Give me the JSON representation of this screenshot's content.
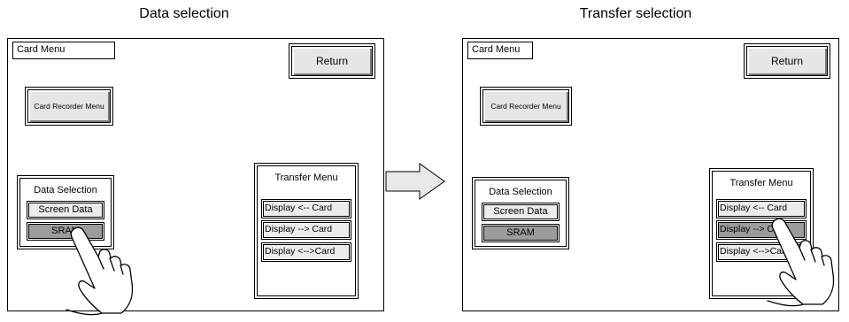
{
  "captions": {
    "left": "Data selection",
    "right": "Transfer selection"
  },
  "screens": [
    {
      "title": "Card Menu",
      "return_label": "Return",
      "card_recorder_label": "Card Recorder Menu",
      "data_selection": {
        "title": "Data Selection",
        "items": [
          "Screen Data",
          "SRAM"
        ],
        "selected": "SRAM"
      },
      "transfer_menu": {
        "title": "Transfer Menu",
        "items": [
          "Display <-- Card",
          "Display --> Card",
          "Display <-->Card"
        ],
        "selected": ""
      }
    },
    {
      "title": "Card Menu",
      "return_label": "Return",
      "card_recorder_label": "Card Recorder Menu",
      "data_selection": {
        "title": "Data Selection",
        "items": [
          "Screen Data",
          "SRAM"
        ],
        "selected": "SRAM"
      },
      "transfer_menu": {
        "title": "Transfer Menu",
        "items": [
          "Display <-- Card",
          "Display --> Card",
          "Display <-->Card"
        ],
        "selected": "Display --> Card"
      }
    }
  ],
  "colors": {
    "selected_fill": "#9c9c9c",
    "button_fill": "#e6e6e6",
    "arrow_fill": "#e8e8e8"
  }
}
